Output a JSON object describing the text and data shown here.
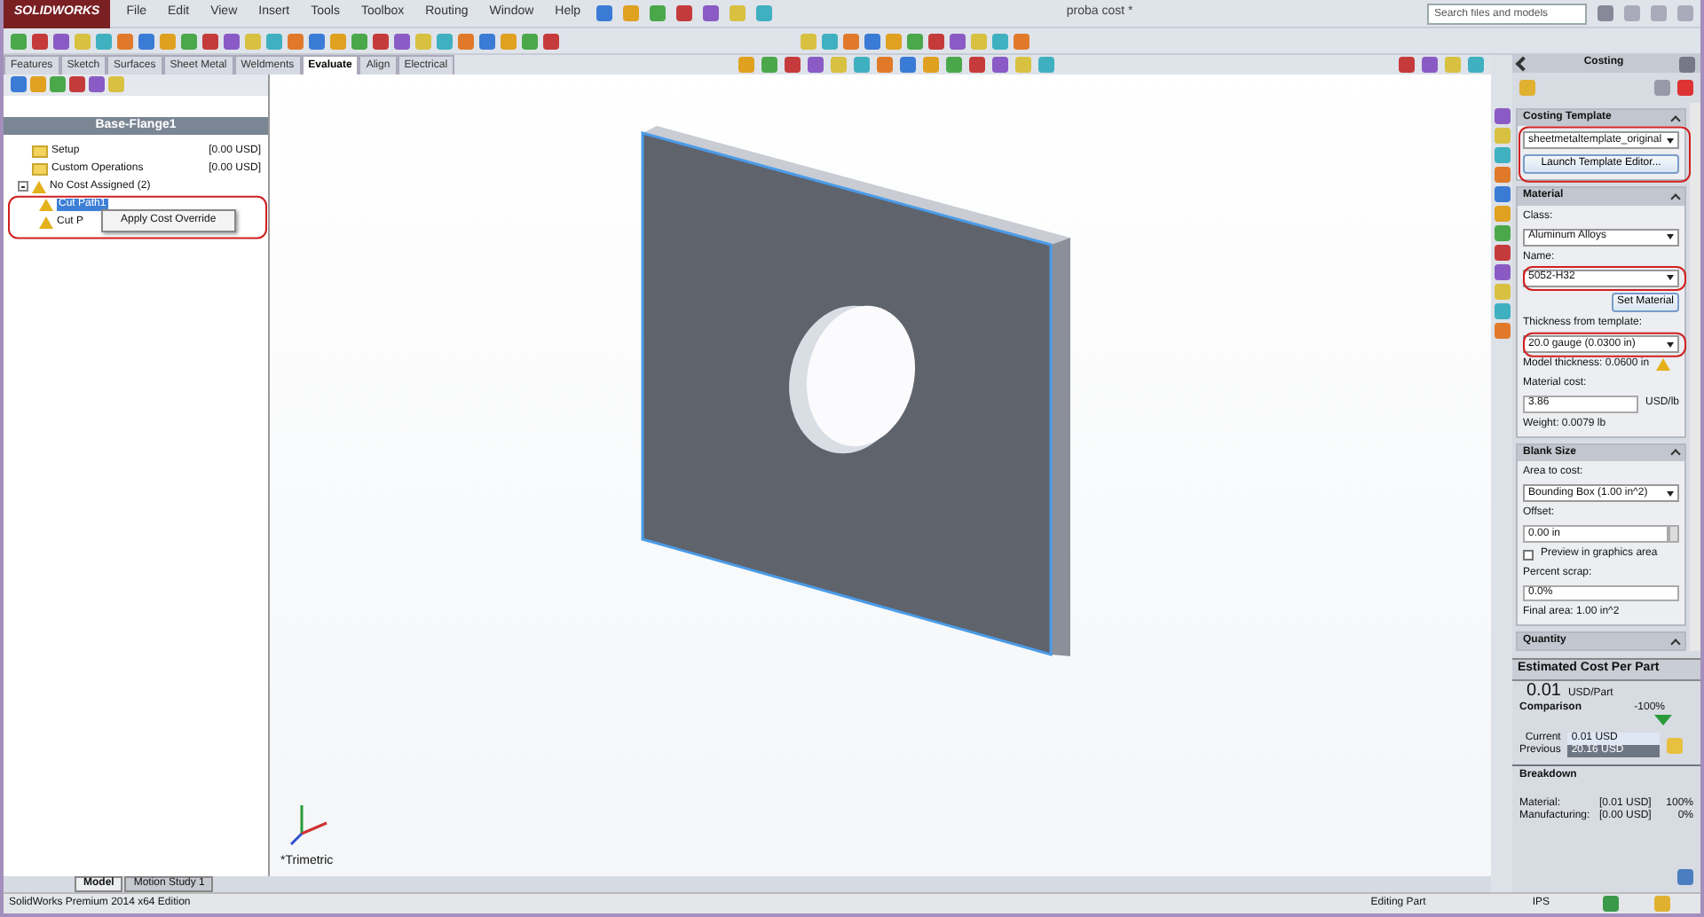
{
  "window": {
    "title": "proba cost *",
    "app_name": "SOLIDWORKS"
  },
  "menu": [
    "File",
    "Edit",
    "View",
    "Insert",
    "Tools",
    "Toolbox",
    "Routing",
    "Window",
    "Help"
  ],
  "search": {
    "placeholder": "Search files and models"
  },
  "command_tabs": [
    {
      "label": "Features",
      "selected": false
    },
    {
      "label": "Sketch",
      "selected": false
    },
    {
      "label": "Surfaces",
      "selected": false
    },
    {
      "label": "Sheet Metal",
      "selected": false
    },
    {
      "label": "Weldments",
      "selected": false
    },
    {
      "label": "Evaluate",
      "selected": true
    },
    {
      "label": "Align",
      "selected": false
    },
    {
      "label": "Electrical",
      "selected": false
    }
  ],
  "feature_tree": {
    "title": "Base-Flange1",
    "items": [
      {
        "kind": "folder",
        "label": "Setup",
        "value": "[0.00 USD]"
      },
      {
        "kind": "folder",
        "label": "Custom Operations",
        "value": "[0.00 USD]"
      },
      {
        "kind": "warning",
        "label": "No Cost Assigned (2)",
        "expanded": true,
        "children": [
          {
            "kind": "warning",
            "label": "Cut Path1",
            "selected": true
          },
          {
            "kind": "warning",
            "label": "Cut P",
            "selected": false
          }
        ]
      }
    ]
  },
  "context_menu": {
    "items": [
      "Apply Cost Override"
    ]
  },
  "graphics": {
    "view_label": "*Trimetric"
  },
  "bottom_tabs": [
    {
      "label": "Model",
      "selected": true
    },
    {
      "label": "Motion Study 1",
      "selected": false
    }
  ],
  "costing": {
    "title": "Costing",
    "template": {
      "header": "Costing Template",
      "dropdown": "sheetmetaltemplate_original",
      "button": "Launch Template Editor..."
    },
    "material": {
      "header": "Material",
      "class_label": "Class:",
      "class_value": "Aluminum Alloys",
      "name_label": "Name:",
      "name_value": "5052-H32",
      "set_button": "Set Material",
      "thickness_label": "Thickness from template:",
      "thickness_value": "20.0 gauge (0.0300 in)",
      "model_thickness": "Model thickness: 0.0600 in",
      "cost_label": "Material cost:",
      "cost_value": "3.86",
      "cost_unit": "USD/lb",
      "weight": "Weight: 0.0079 lb"
    },
    "blank_size": {
      "header": "Blank Size",
      "area_label": "Area to cost:",
      "area_value": "Bounding Box (1.00 in^2)",
      "offset_label": "Offset:",
      "offset_value": "0.00 in",
      "preview_label": "Preview in graphics area",
      "preview_checked": false,
      "scrap_label": "Percent scrap:",
      "scrap_value": "0.0%",
      "final_area": "Final area: 1.00 in^2"
    },
    "quantity": {
      "header": "Quantity"
    },
    "estimate": {
      "header": "Estimated Cost Per Part",
      "value": "0.01",
      "unit": "USD/Part",
      "comparison_label": "Comparison",
      "comparison_pct": "-100%",
      "current_label": "Current",
      "current_value": "0.01 USD",
      "previous_label": "Previous",
      "previous_value": "20.16 USD"
    },
    "breakdown": {
      "header": "Breakdown",
      "rows": [
        {
          "label": "Material:",
          "cost": "[0.01 USD]",
          "share": "100%"
        },
        {
          "label": "Manufacturing:",
          "cost": "[0.00 USD]",
          "share": "0%"
        }
      ]
    }
  },
  "status_bar": {
    "edition": "SolidWorks Premium 2014 x64 Edition",
    "mode": "Editing Part",
    "units": "IPS"
  }
}
